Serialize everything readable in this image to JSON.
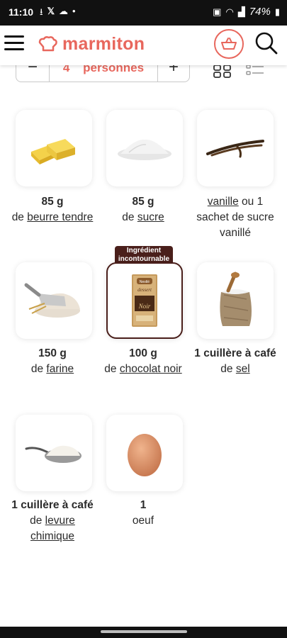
{
  "status_bar": {
    "time": "11:10",
    "battery": "74%"
  },
  "header": {
    "logo_text": "marmiton",
    "brand_color": "#e8675d"
  },
  "servings": {
    "minus": "−",
    "count_text": "4 personnes",
    "plus": "+"
  },
  "badge": {
    "line1": "Ingrédient",
    "line2": "incontournable"
  },
  "ingredients": [
    {
      "qty": "85 g",
      "pre": "de ",
      "link": "beurre tendre",
      "post": "",
      "icon": "butter-image"
    },
    {
      "qty": "85 g",
      "pre": "de ",
      "link": "sucre",
      "post": "",
      "icon": "sugar-image"
    },
    {
      "qty": "",
      "pre": "",
      "link": "vanille",
      "post": " ou 1 sachet de sucre vanillé",
      "icon": "vanilla-image"
    },
    {
      "qty": "150 g",
      "pre": "de ",
      "link": "farine",
      "post": "",
      "icon": "flour-image"
    },
    {
      "qty": "100 g",
      "pre": "de ",
      "link": "chocolat noir",
      "post": "",
      "icon": "chocolate-image",
      "featured": true
    },
    {
      "qty": "1 cuillère à café",
      "pre": "de ",
      "link": "sel",
      "post": "",
      "icon": "salt-image"
    },
    {
      "qty": "1 cuillère à café",
      "pre": "de ",
      "link": "levure chimique",
      "post": "",
      "icon": "baking-powder-image"
    },
    {
      "qty": "1",
      "pre": "oeuf",
      "link": "",
      "post": "",
      "icon": "egg-image"
    }
  ],
  "chocolate_pack": {
    "brand": "Nestlé",
    "line": "dessert",
    "name": "Noir"
  }
}
